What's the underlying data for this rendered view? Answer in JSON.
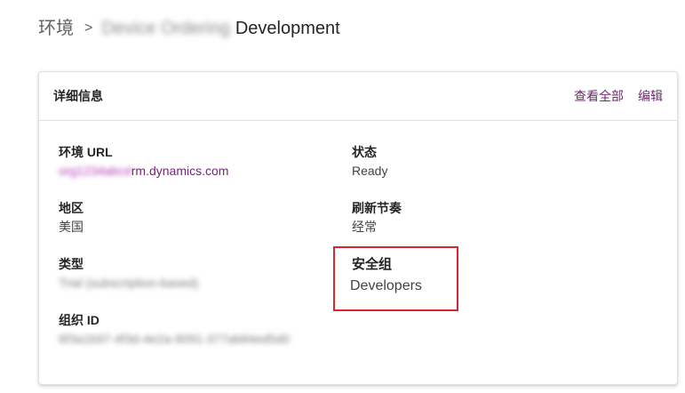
{
  "breadcrumb": {
    "root": "环境",
    "separator": ">",
    "blurred_name": "Device Ordering",
    "current": "Development"
  },
  "card": {
    "title": "详细信息",
    "actions": {
      "view_all": "查看全部",
      "edit": "编辑"
    },
    "fields": {
      "env_url": {
        "label": "环境 URL",
        "value_blurred": "org1234abcd",
        "value_visible": "rm.dynamics.com"
      },
      "region": {
        "label": "地区",
        "value": "美国"
      },
      "type": {
        "label": "类型",
        "value_blurred": "Trial (subscription-based)"
      },
      "org_id": {
        "label": "组织 ID",
        "value_blurred": "6f3a1b97-4f3d-4e2a-9091-377ab84ed5d0"
      },
      "state": {
        "label": "状态",
        "value": "Ready"
      },
      "refresh_cadence": {
        "label": "刷新节奏",
        "value": "经常"
      },
      "security_group": {
        "label": "安全组",
        "value": "Developers"
      }
    }
  },
  "colors": {
    "link": "#742774",
    "highlight_border": "#d9262e"
  }
}
